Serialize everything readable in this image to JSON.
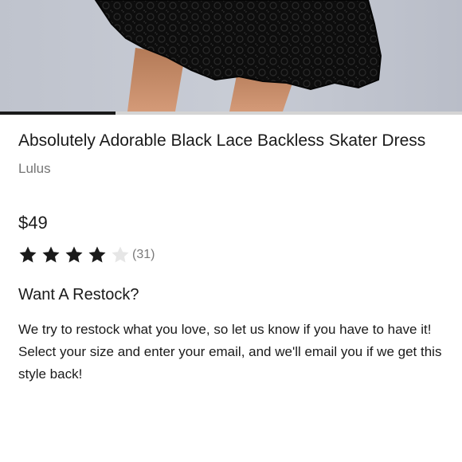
{
  "product": {
    "title": "Absolutely Adorable Black Lace Backless Skater Dress",
    "brand": "Lulus",
    "price": "$49",
    "rating": {
      "value": 4,
      "max": 5,
      "review_count": "(31)"
    }
  },
  "gallery": {
    "progress": 0.25
  },
  "restock": {
    "heading": "Want A Restock?",
    "line1": "We try to restock what you love, so let us know if you have to have it!",
    "line2": "Select your size and enter your email, and we'll email you if we get this style back!"
  },
  "colors": {
    "star_filled": "#1a1a1a",
    "star_empty": "#e6e6e6",
    "brand_text": "#757575"
  },
  "icons": {
    "filled_star": "star-filled-icon",
    "empty_star": "star-empty-icon"
  }
}
